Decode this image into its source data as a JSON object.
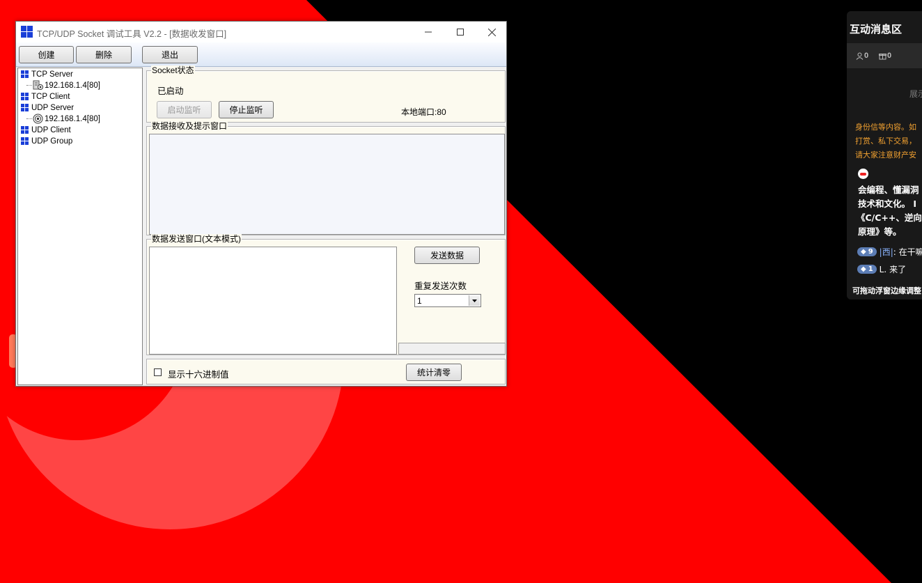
{
  "window": {
    "title": "TCP/UDP Socket 调试工具 V2.2 - [数据收发窗口]"
  },
  "toolbar": {
    "create_label": "创建",
    "delete_label": "删除",
    "exit_label": "退出"
  },
  "tree": {
    "nodes": [
      {
        "label": "TCP Server",
        "children": [
          "192.168.1.4[80]"
        ]
      },
      {
        "label": "TCP Client",
        "children": []
      },
      {
        "label": "UDP Server",
        "children": [
          "192.168.1.4[80]"
        ]
      },
      {
        "label": "UDP Client",
        "children": []
      },
      {
        "label": "UDP Group",
        "children": []
      }
    ]
  },
  "socket_status": {
    "group_label": "Socket状态",
    "status": "已启动",
    "start_label": "启动监听",
    "stop_label": "停止监听",
    "local_port": "本地端口:80"
  },
  "receive": {
    "group_label": "数据接收及提示窗口",
    "value": ""
  },
  "send": {
    "group_label": "数据发送窗口(文本模式)",
    "value": "",
    "send_label": "发送数据",
    "repeat_label": "重复发送次数",
    "repeat_value": "1"
  },
  "bottom": {
    "hex_label": "显示十六进制值",
    "hex_checked": false,
    "reset_label": "统计清零"
  },
  "side_panel": {
    "title": "互动消息区",
    "viewers": "0",
    "gifts": "0",
    "display_text": "展示",
    "warn_line1": "身份信等内容。如",
    "warn_line2": "打赏、私下交易，",
    "warn_line3": "请大家注意财产安",
    "bio_line1": "会编程、懂漏洞",
    "bio_line2": "技术和文化。 I",
    "bio_line3": "《C/C++、逆向",
    "bio_line4": "原理》等。",
    "msg1_level": "9",
    "msg1_user": "|西|",
    "msg1_text": ": 在干嘛",
    "msg2_level": "1",
    "msg2_user": "L.",
    "msg2_text": "来了",
    "footer": "可拖动浮窗边缘调整"
  },
  "colors": {
    "desktop_red": "#ff0000",
    "desktop_black": "#000000",
    "side_bg": "#191919",
    "warn_orange": "#f0a030",
    "badge_blue": "#5c7db5"
  }
}
